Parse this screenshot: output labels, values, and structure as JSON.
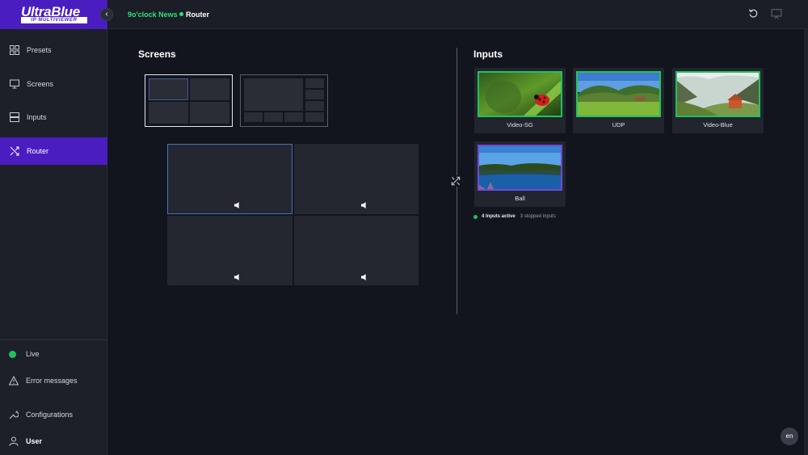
{
  "app": {
    "brand": "UltraBlue",
    "subbrand": "IP MULTIVIEWER"
  },
  "breadcrumb": {
    "project": "9o'clock News",
    "page": "Router"
  },
  "sidebar": {
    "items": [
      {
        "label": "Presets",
        "icon": "grid-icon"
      },
      {
        "label": "Screens",
        "icon": "monitor-icon"
      },
      {
        "label": "Inputs",
        "icon": "stack-icon"
      },
      {
        "label": "Router",
        "icon": "shuffle-icon",
        "active": true
      }
    ],
    "bottom": {
      "live": "Live",
      "errors": "Error messages",
      "config": "Configurations",
      "user": "User"
    }
  },
  "screens": {
    "title": "Screens"
  },
  "inputs": {
    "title": "Inputs",
    "cards": [
      {
        "label": "Video-SG",
        "image": "ladybug-on-leaf"
      },
      {
        "label": "UDP",
        "image": "green-valley-hills"
      },
      {
        "label": "Video-Blue",
        "image": "mountain-cabin"
      },
      {
        "label": "Ball",
        "image": "lake-forest-reflection"
      }
    ],
    "status_active": "4 Inputs active",
    "status_stopped": "3 stopped inputs"
  },
  "lang": "en",
  "colors": {
    "accent": "#4a1dc0",
    "live": "#21c25e",
    "breadcrumb": "#2ee07a"
  }
}
